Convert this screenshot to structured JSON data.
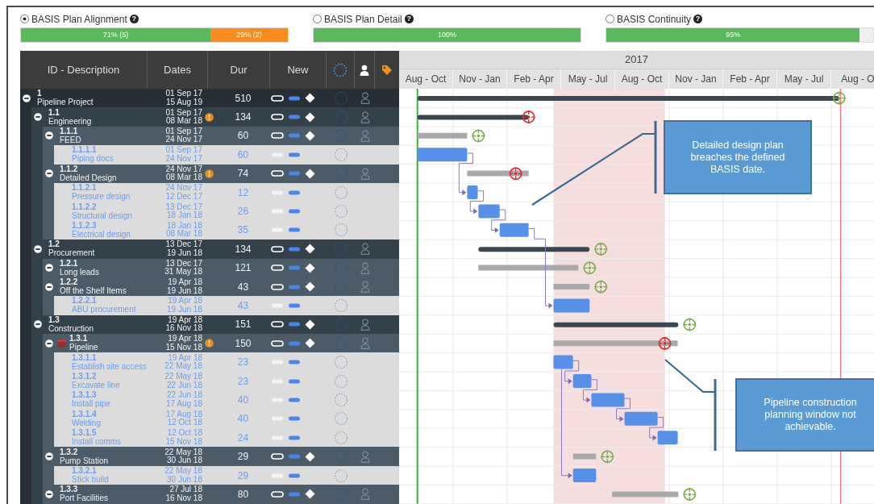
{
  "metrics": [
    {
      "label": "BASIS Plan Alignment",
      "help": "?",
      "selected": true,
      "segments": [
        {
          "text": "71% (5)",
          "level": 0.71,
          "kind": "pass"
        },
        {
          "text": "29% (2)",
          "level": 0.29,
          "kind": "fail"
        }
      ]
    },
    {
      "label": "BASIS Plan Detail",
      "help": "?",
      "selected": false,
      "segments": [
        {
          "text": "100%",
          "level": 1,
          "kind": "pass"
        }
      ]
    },
    {
      "label": "BASIS Continuity",
      "help": "?",
      "selected": false,
      "segments": [
        {
          "text": "95%",
          "level": 0.95,
          "kind": "pass"
        }
      ]
    }
  ],
  "table": {
    "columns": [
      "ID - Description",
      "Dates",
      "Dur",
      "New"
    ]
  },
  "gantt": {
    "year": "2017",
    "quarters": [
      "Aug - Oct",
      "Nov - Jan",
      "Feb - Apr",
      "May - Jul",
      "Aug - Oct",
      "Nov - Jan",
      "Feb - Apr",
      "May - Jul",
      "Aug - O"
    ],
    "callouts": [
      {
        "text": "Detailed design plan breaches the defined BASIS date."
      },
      {
        "text": "Pipeline construction planning window not achievable."
      }
    ]
  },
  "rows": [
    {
      "kind": "group",
      "id": "1",
      "name": "Pipeline Project",
      "start": "01 Sep 17",
      "end": "15 Aug 19",
      "dur": "510",
      "expanded": true,
      "breached": false,
      "children": [
        {
          "kind": "group",
          "id": "1.1",
          "name": "Engineering",
          "start": "01 Sep 17",
          "end": "08 Mar 18",
          "dur": "134",
          "warning": true,
          "expanded": true,
          "breached": true,
          "children": [
            {
              "kind": "group",
              "id": "1.1.1",
              "name": "FEED",
              "start": "01 Sep 17",
              "end": "24 Nov 17",
              "dur": "60",
              "expanded": true,
              "breached": false,
              "children": [
                {
                  "kind": "task",
                  "id": "1.1.1.1",
                  "name": "Piping docs",
                  "start": "01 Sep 17",
                  "end": "24 Nov 17",
                  "dur": "60"
                }
              ]
            },
            {
              "kind": "group",
              "id": "1.1.2",
              "name": "Detailed Design",
              "start": "24 Nov 17",
              "end": "08 Mar 18",
              "dur": "74",
              "warning": true,
              "expanded": true,
              "breached": true,
              "children": [
                {
                  "kind": "task",
                  "id": "1.1.2.1",
                  "name": "Pressure design",
                  "start": "24 Nov 17",
                  "end": "12 Dec 17",
                  "dur": "12"
                },
                {
                  "kind": "task",
                  "id": "1.1.2.2",
                  "name": "Structural design",
                  "start": "13 Dec 17",
                  "end": "18 Jan 18",
                  "dur": "26"
                },
                {
                  "kind": "task",
                  "id": "1.1.2.3",
                  "name": "Electrical design",
                  "start": "18 Jan 18",
                  "end": "08 Mar 18",
                  "dur": "35"
                }
              ]
            }
          ]
        },
        {
          "kind": "group",
          "id": "1.2",
          "name": "Procurement",
          "start": "13 Dec 17",
          "end": "19 Jun 18",
          "dur": "134",
          "expanded": true,
          "breached": false,
          "children": [
            {
              "kind": "group",
              "id": "1.2.1",
              "name": "Long leads",
              "start": "13 Dec 17",
              "end": "31 May 18",
              "dur": "121",
              "expanded": true,
              "breached": false
            },
            {
              "kind": "group",
              "id": "1.2.2",
              "name": "Off the Shelf Items",
              "start": "19 Apr 18",
              "end": "19 Jun 18",
              "dur": "43",
              "expanded": true,
              "breached": false,
              "children": [
                {
                  "kind": "task",
                  "id": "1.2.2.1",
                  "name": "ABU procurement",
                  "start": "19 Apr 18",
                  "end": "19 Jun 18",
                  "dur": "43"
                }
              ]
            }
          ]
        },
        {
          "kind": "group",
          "id": "1.3",
          "name": "Construction",
          "start": "19 Apr 18",
          "end": "16 Nov 18",
          "dur": "151",
          "expanded": true,
          "breached": false,
          "children": [
            {
              "kind": "group",
              "id": "1.3.1",
              "name": "Pipeline",
              "start": "19 Apr 18",
              "end": "15 Nov 18",
              "dur": "150",
              "warning": true,
              "flagged": true,
              "expanded": true,
              "breached": true,
              "children": [
                {
                  "kind": "task",
                  "id": "1.3.1.1",
                  "name": "Establish site access",
                  "start": "19 Apr 18",
                  "end": "22 May 18",
                  "dur": "23"
                },
                {
                  "kind": "task",
                  "id": "1.3.1.2",
                  "name": "Excavate line",
                  "start": "22 May 18",
                  "end": "22 Jun 18",
                  "dur": "23"
                },
                {
                  "kind": "task",
                  "id": "1.3.1.3",
                  "name": "Install pipe",
                  "start": "22 Jun 18",
                  "end": "17 Aug 18",
                  "dur": "40"
                },
                {
                  "kind": "task",
                  "id": "1.3.1.4",
                  "name": "Welding",
                  "start": "17 Aug 18",
                  "end": "12 Oct 18",
                  "dur": "40"
                },
                {
                  "kind": "task",
                  "id": "1.3.1.5",
                  "name": "Install comms",
                  "start": "12 Oct 18",
                  "end": "15 Nov 18",
                  "dur": "24"
                }
              ]
            },
            {
              "kind": "group",
              "id": "1.3.2",
              "name": "Pump Station",
              "start": "22 May 18",
              "end": "30 Jun 18",
              "dur": "29",
              "expanded": true,
              "breached": false,
              "children": [
                {
                  "kind": "task",
                  "id": "1.3.2.1",
                  "name": "Stick build",
                  "start": "22 May 18",
                  "end": "30 Jun 18",
                  "dur": "29"
                }
              ]
            },
            {
              "kind": "group",
              "id": "1.3.3",
              "name": "Port Facilities",
              "start": "27 Jul 18",
              "end": "16 Nov 18",
              "dur": "80",
              "expanded": true,
              "breached": false
            }
          ]
        }
      ]
    }
  ]
}
